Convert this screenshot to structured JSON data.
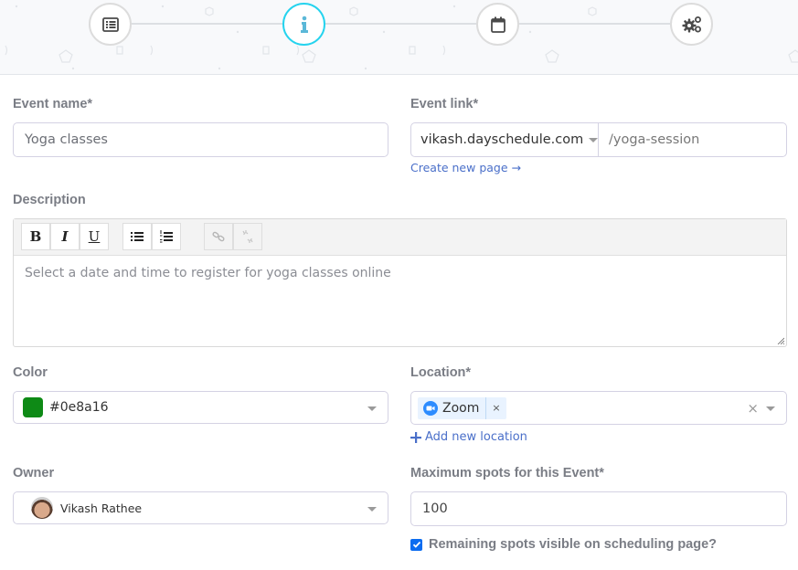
{
  "stepper": {
    "steps": [
      {
        "name": "details",
        "icon": "list-icon",
        "active": false
      },
      {
        "name": "info",
        "icon": "info-icon",
        "active": true
      },
      {
        "name": "schedule",
        "icon": "calendar-icon",
        "active": false
      },
      {
        "name": "settings",
        "icon": "gears-icon",
        "active": false
      }
    ],
    "colors": {
      "active": "#25d3ee",
      "inactive": "#dcdcdc"
    }
  },
  "form": {
    "event_name": {
      "label": "Event name*",
      "value": "Yoga classes"
    },
    "event_link": {
      "label": "Event link*",
      "domain": "vikash.dayschedule.com",
      "slug": "/yoga-session",
      "create_page_link": "Create new page →"
    },
    "description": {
      "label": "Description",
      "toolbar": {
        "bold": "B",
        "italic": "I",
        "underline": "U",
        "bullet_list": "bulleted-list-icon",
        "numbered_list": "numbered-list-icon",
        "link": "link-icon",
        "unlink": "unlink-icon"
      },
      "value": "Select a date and time to register for yoga classes online"
    },
    "color": {
      "label": "Color",
      "value": "#0e8a16",
      "swatch": "#0e8a16"
    },
    "location": {
      "label": "Location*",
      "tags": [
        {
          "label": "Zoom",
          "icon": "zoom-icon",
          "remove": "×"
        }
      ],
      "clear": "×",
      "add_link": "Add new location"
    },
    "owner": {
      "label": "Owner",
      "value": "Vikash Rathee"
    },
    "max_spots": {
      "label": "Maximum spots for this Event*",
      "value": "100"
    },
    "remaining_visible": {
      "label": "Remaining spots visible on scheduling page?",
      "checked": true
    }
  }
}
